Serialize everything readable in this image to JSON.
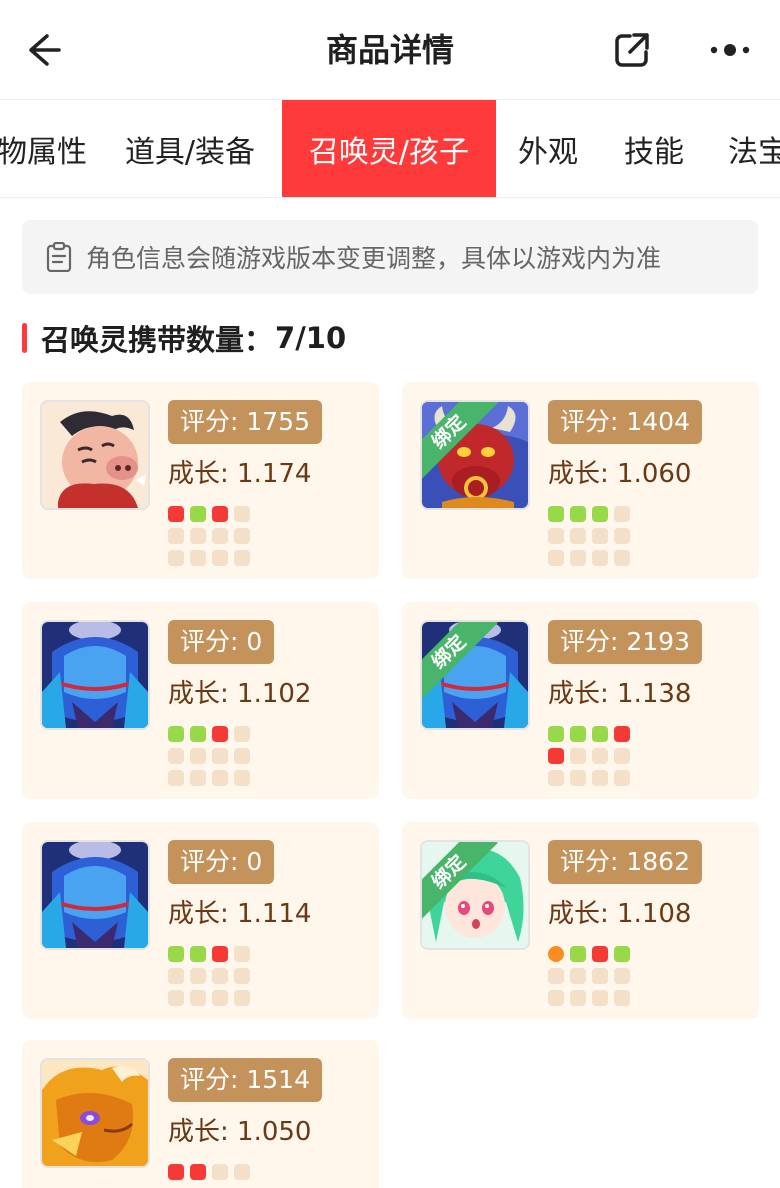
{
  "header": {
    "title": "商品详情",
    "back_icon": "arrow-left-icon",
    "share_icon": "share-icon",
    "more_icon": "more-icon"
  },
  "tabs": [
    {
      "label": "物属性"
    },
    {
      "label": "道具/装备"
    },
    {
      "label": "召唤灵/孩子",
      "active": true
    },
    {
      "label": "外观"
    },
    {
      "label": "技能"
    },
    {
      "label": "法宝"
    }
  ],
  "notice": {
    "icon": "clipboard-icon",
    "text": "角色信息会随游戏版本变更调整，具体以游戏内为准"
  },
  "section": {
    "label": "召唤灵携带数量：",
    "count": "7/10"
  },
  "colors": {
    "accent": "#ff3a3a",
    "score_badge": "#c4925b",
    "card_bg": "#fff6ec",
    "growth_text": "#6a3812",
    "bound_ribbon": "#49b56b",
    "pip_red": "#f53a35",
    "pip_green": "#98d94a",
    "pip_orange": "#fb8d1e",
    "pip_empty": "#f4dfc9"
  },
  "pets": [
    {
      "avatar": "boar-character",
      "bound": false,
      "score": "评分: 1755",
      "growth": "成长: 1.174",
      "pips": [
        "red",
        "green",
        "red",
        "empty",
        "empty",
        "empty",
        "empty",
        "empty",
        "empty",
        "empty",
        "empty",
        "empty"
      ]
    },
    {
      "avatar": "red-bull-demon",
      "bound": true,
      "bound_label": "绑定",
      "score": "评分: 1404",
      "growth": "成长: 1.060",
      "pips": [
        "green",
        "green",
        "green",
        "empty",
        "empty",
        "empty",
        "empty",
        "empty",
        "empty",
        "empty",
        "empty",
        "empty"
      ]
    },
    {
      "avatar": "blue-armored-warrior",
      "bound": false,
      "score": "评分: 0",
      "growth": "成长: 1.102",
      "pips": [
        "green",
        "green",
        "red",
        "empty",
        "empty",
        "empty",
        "empty",
        "empty",
        "empty",
        "empty",
        "empty",
        "empty"
      ]
    },
    {
      "avatar": "blue-armored-warrior",
      "bound": true,
      "bound_label": "绑定",
      "score": "评分: 2193",
      "growth": "成长: 1.138",
      "pips": [
        "green",
        "green",
        "green",
        "red",
        "red",
        "empty",
        "empty",
        "empty",
        "empty",
        "empty",
        "empty",
        "empty"
      ]
    },
    {
      "avatar": "blue-armored-warrior",
      "bound": false,
      "score": "评分: 0",
      "growth": "成长: 1.114",
      "pips": [
        "green",
        "green",
        "red",
        "empty",
        "empty",
        "empty",
        "empty",
        "empty",
        "empty",
        "empty",
        "empty",
        "empty"
      ]
    },
    {
      "avatar": "green-haired-girl",
      "bound": true,
      "bound_label": "绑定",
      "score": "评分: 1862",
      "growth": "成长: 1.108",
      "pips": [
        "orange",
        "green",
        "red",
        "green",
        "empty",
        "empty",
        "empty",
        "empty",
        "empty",
        "empty",
        "empty",
        "empty"
      ]
    },
    {
      "avatar": "golden-dragon",
      "bound": false,
      "score": "评分: 1514",
      "growth": "成长: 1.050",
      "pips": [
        "red",
        "red",
        "empty",
        "empty"
      ]
    }
  ]
}
